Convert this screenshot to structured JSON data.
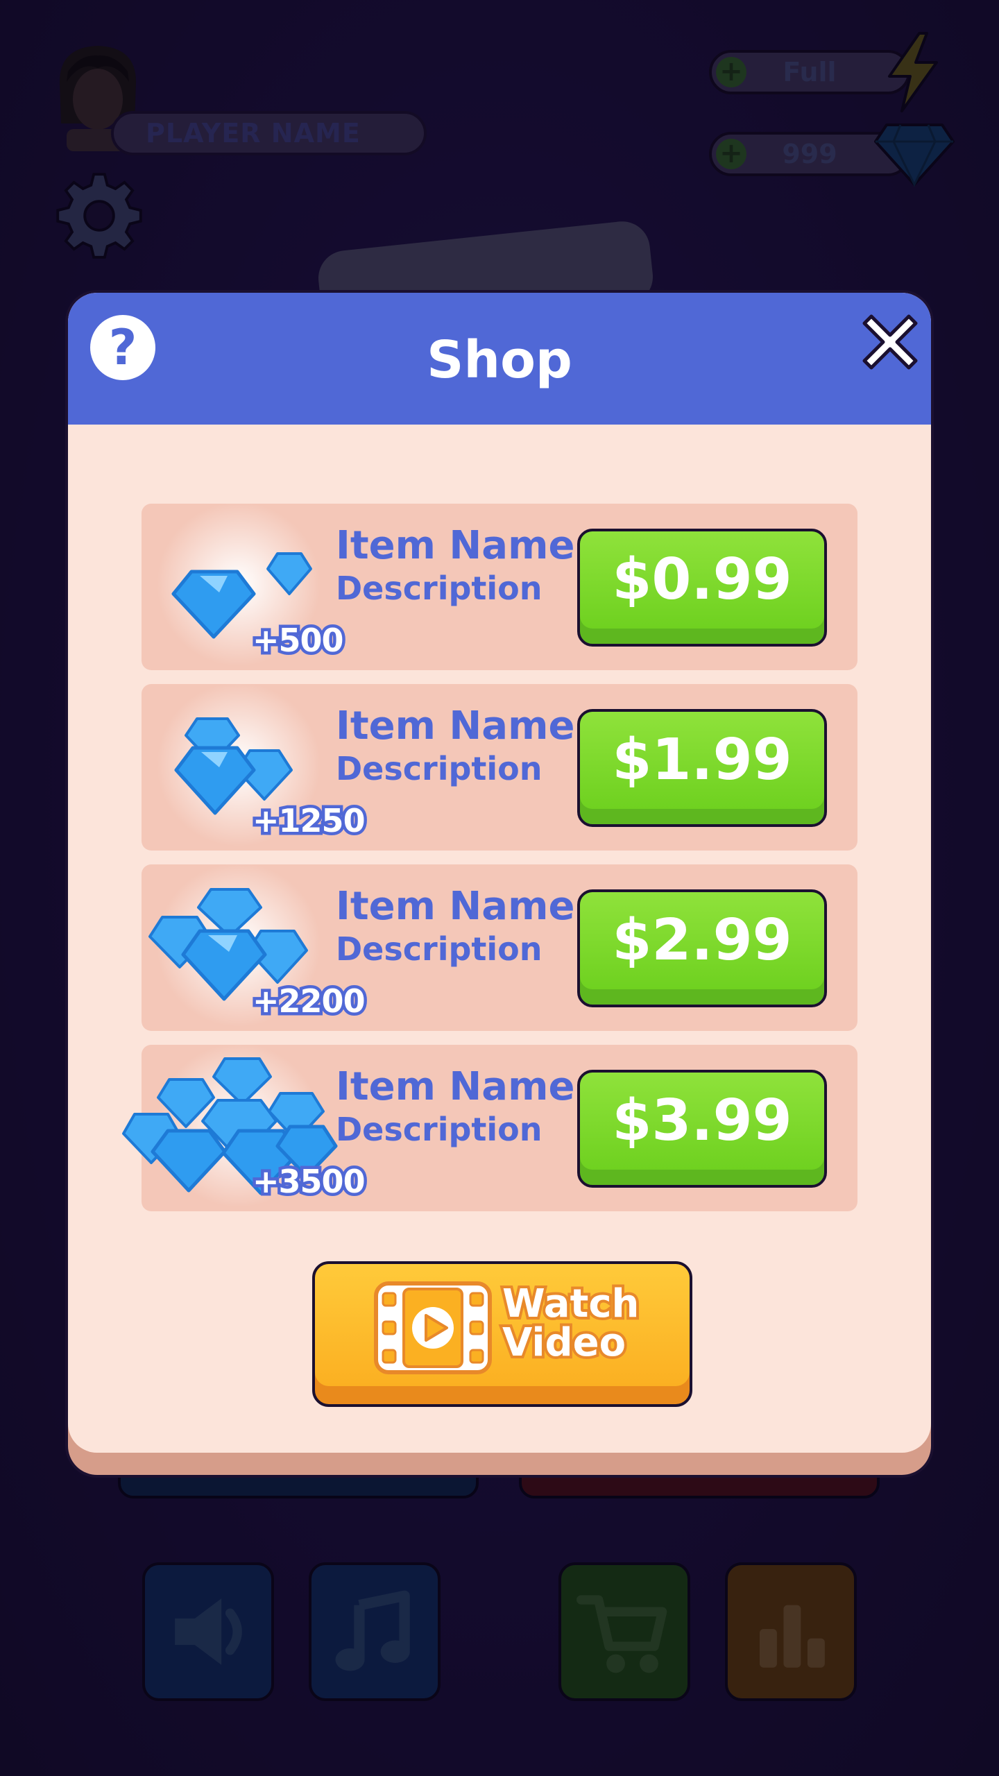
{
  "hud": {
    "player_name": "PLAYER NAME",
    "energy_value": "Full",
    "gems_value": "999",
    "plus_symbol": "+"
  },
  "shop": {
    "title": "Shop",
    "help_symbol": "?",
    "items": [
      {
        "name": "Item Name",
        "description": "Description",
        "amount": "+500",
        "price": "$0.99"
      },
      {
        "name": "Item Name",
        "description": "Description",
        "amount": "+1250",
        "price": "$1.99"
      },
      {
        "name": "Item Name",
        "description": "Description",
        "amount": "+2200",
        "price": "$2.99"
      },
      {
        "name": "Item Name",
        "description": "Description",
        "amount": "+3500",
        "price": "$3.99"
      }
    ],
    "watch_video": {
      "line1": "Watch",
      "line2": "Video"
    }
  },
  "bottom_bar": [
    "speaker-icon",
    "music-note-icon",
    "cart-icon",
    "leaderboard-icon"
  ],
  "colors": {
    "header_blue": "#5068d6",
    "panel_bg": "#fce4da",
    "row_bg": "#f4c7b8",
    "price_green": "#6fd120",
    "watch_orange": "#fbb022",
    "gem_blue": "#2f9cf0"
  }
}
